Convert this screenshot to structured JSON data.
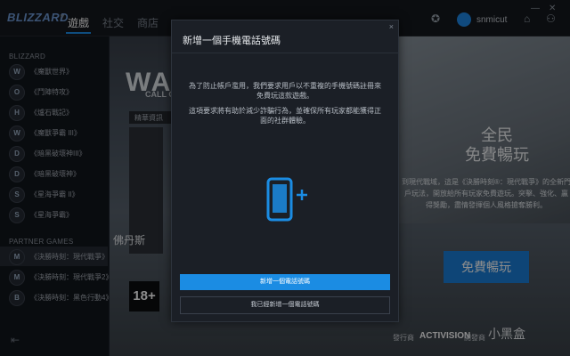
{
  "topbar": {
    "logo": "BLIZZARD",
    "nav": [
      "遊戲",
      "社交",
      "商店"
    ],
    "username": "snmicut"
  },
  "sidebar": {
    "heading_blizzard": "BLIZZARD",
    "games": [
      "《魔獸世界》",
      "《鬥陣特攻》",
      "《爐石戰記》",
      "《魔獸爭霸 III》",
      "《暗黑破壞神III》",
      "《暗黑破壞神》",
      "《星海爭霸 II》",
      "《星海爭霸》"
    ],
    "heading_partner": "PARTNER GAMES",
    "partner_games": [
      "《決勝時刻：現代戰爭》",
      "《決勝時刻：現代戰爭2》",
      "《決勝時刻：黑色行動4》"
    ],
    "collapse_icon": "collapse-left-icon"
  },
  "main": {
    "banner_title": "WAR",
    "banner_title_small": "CALL OF DUTY",
    "tab_label": "精華資訊",
    "left_tile_text": "佛丹斯",
    "rating": "18+",
    "promo_title_line1": "全民",
    "promo_title_line2": "免費暢玩",
    "promo_text": "到現代戰域，這是《決勝時刻®：現代戰爭》的全新門戶玩法，開放給所有玩家免費遊玩。突擊、強化、贏得獎勵，盡情發揮個人風格搶奪勝利。",
    "promo_button": "免費暢玩",
    "publisher_label": "發行商",
    "publisher": "ACTIVISION",
    "developer_label": "開發商",
    "watermark": "小黑盒"
  },
  "modal": {
    "title": "新增一個手機電話號碼",
    "paragraph1": "為了防止帳戶濫用，我們要求用戶以不重複的手機號碼註冊來免費玩這款遊戲。",
    "paragraph2": "這項要求將有助於減少詐騙行為，並確保所有玩家都能獲得正面的社群體驗。",
    "primary_button": "新增一個電話號碼",
    "secondary_button": "我已經新增一個電話號碼",
    "close": "×"
  },
  "colors": {
    "accent": "#1b8ce3",
    "background": "#0e1116"
  }
}
